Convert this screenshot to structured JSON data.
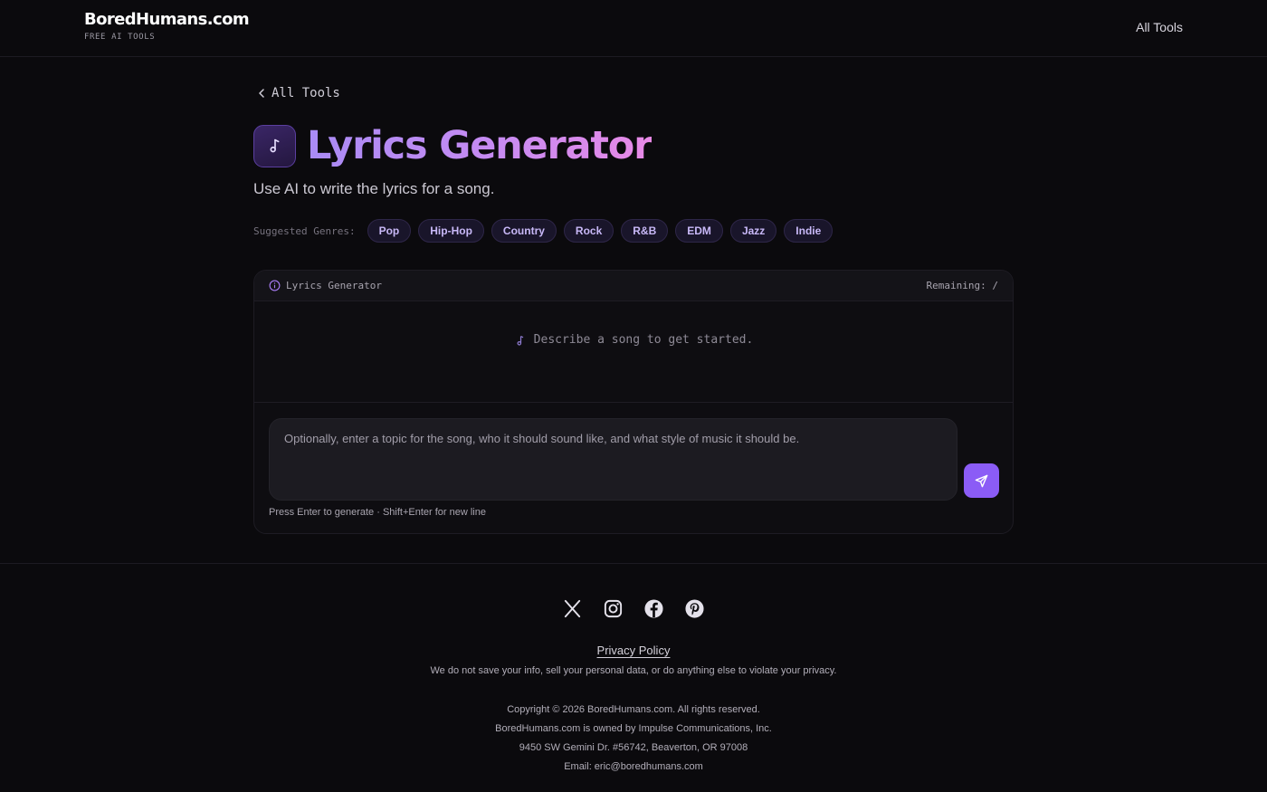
{
  "header": {
    "brand_name": "BoredHumans.com",
    "brand_tagline": "FREE AI TOOLS",
    "nav_all_tools": "All Tools"
  },
  "main": {
    "back_link": "All Tools",
    "title": "Lyrics Generator",
    "subtitle": "Use AI to write the lyrics for a song.",
    "genres_label": "Suggested Genres:",
    "genres": [
      "Pop",
      "Hip-Hop",
      "Country",
      "Rock",
      "R&B",
      "EDM",
      "Jazz",
      "Indie"
    ]
  },
  "panel": {
    "header_title": "Lyrics Generator",
    "remaining": "Remaining: /",
    "empty_state": "Describe a song to get started.",
    "input_placeholder": "Optionally, enter a topic for the song, who it should sound like, and what style of music it should be.",
    "hint": "Press Enter to generate · Shift+Enter for new line"
  },
  "footer": {
    "socials": [
      "x-icon",
      "instagram-icon",
      "facebook-icon",
      "pinterest-icon"
    ],
    "privacy_link": "Privacy Policy",
    "privacy_note": "We do not save your info, sell your personal data, or do anything else to violate your privacy.",
    "lines": [
      "Copyright © 2026 BoredHumans.com. All rights reserved.",
      "BoredHumans.com is owned by Impulse Communications, Inc.",
      "9450 SW Gemini Dr. #56742, Beaverton, OR 97008",
      "Email: eric@boredhumans.com"
    ]
  },
  "colors": {
    "accent": "#8b5cf6",
    "title_gradient_start": "#a98bf5",
    "title_gradient_end": "#e88ae6",
    "background": "#0b0a0d"
  }
}
